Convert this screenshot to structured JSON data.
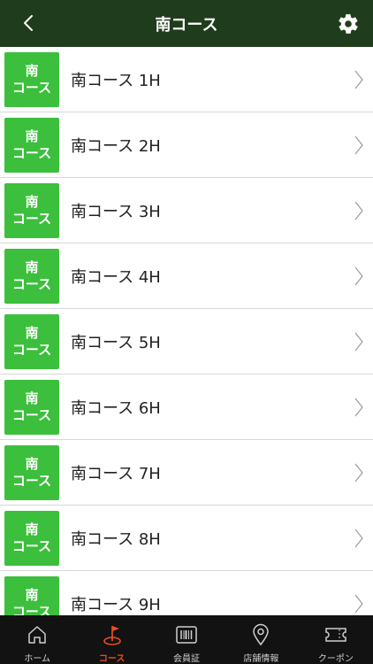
{
  "header": {
    "title": "南コース",
    "back_icon": "chevron-left-icon",
    "settings_icon": "gear-icon"
  },
  "colors": {
    "header_bg": "#1f3d1c",
    "badge_bg": "#3cbf3c",
    "tabbar_bg": "#121212",
    "active_tab": "#f04e1f"
  },
  "holes": [
    {
      "badge_top": "南",
      "badge_bottom": "コース",
      "label": "南コース 1H"
    },
    {
      "badge_top": "南",
      "badge_bottom": "コース",
      "label": "南コース 2H"
    },
    {
      "badge_top": "南",
      "badge_bottom": "コース",
      "label": "南コース 3H"
    },
    {
      "badge_top": "南",
      "badge_bottom": "コース",
      "label": "南コース 4H"
    },
    {
      "badge_top": "南",
      "badge_bottom": "コース",
      "label": "南コース 5H"
    },
    {
      "badge_top": "南",
      "badge_bottom": "コース",
      "label": "南コース 6H"
    },
    {
      "badge_top": "南",
      "badge_bottom": "コース",
      "label": "南コース 7H"
    },
    {
      "badge_top": "南",
      "badge_bottom": "コース",
      "label": "南コース 8H"
    },
    {
      "badge_top": "南",
      "badge_bottom": "コース",
      "label": "南コース 9H"
    }
  ],
  "tabbar": {
    "tabs": [
      {
        "label": "ホーム",
        "icon": "home-icon",
        "active": false
      },
      {
        "label": "コース",
        "icon": "golf-flag-icon",
        "active": true
      },
      {
        "label": "会員証",
        "icon": "barcode-icon",
        "active": false
      },
      {
        "label": "店舗情報",
        "icon": "map-pin-icon",
        "active": false
      },
      {
        "label": "クーポン",
        "icon": "ticket-icon",
        "active": false
      }
    ]
  }
}
